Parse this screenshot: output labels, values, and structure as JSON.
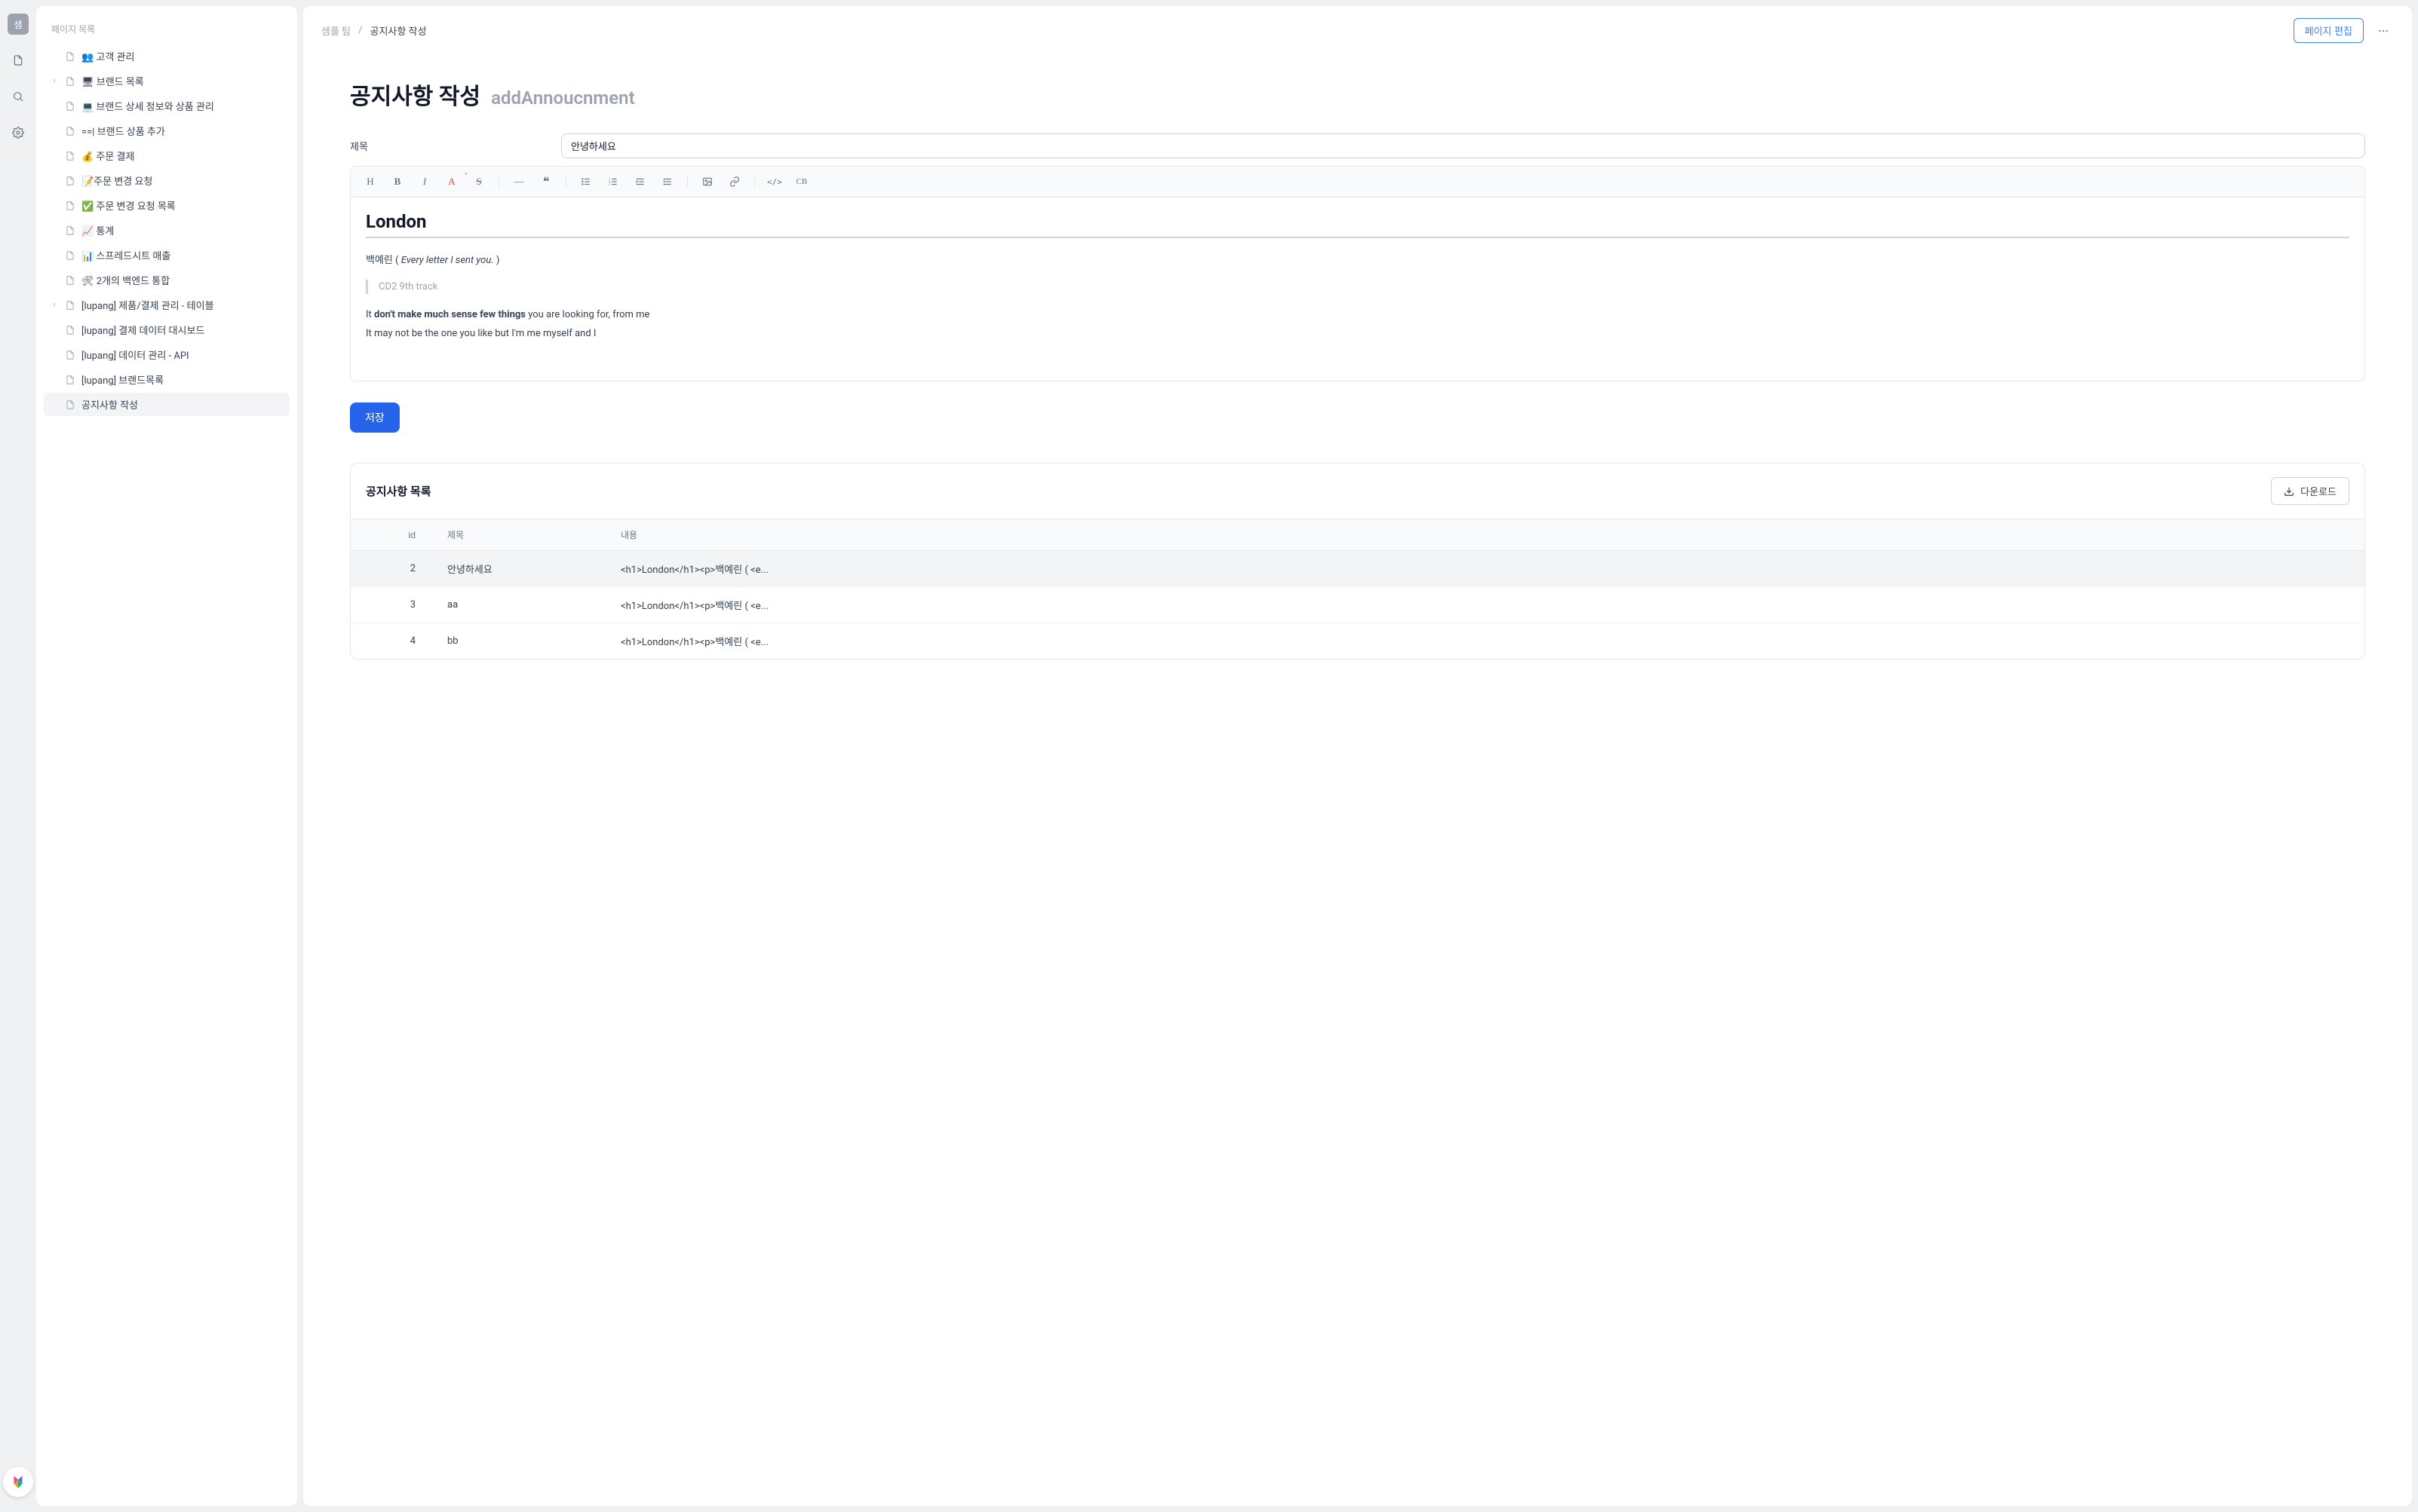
{
  "rail": {
    "avatar_initial": "샘"
  },
  "sidebar": {
    "title": "페이지 목록",
    "items": [
      {
        "label": "👥 고객 관리",
        "expandable": false
      },
      {
        "label": "🖥 브랜드 목록",
        "expandable": true
      },
      {
        "label": "💻 브랜드 상세 정보와 상품 관리",
        "expandable": false
      },
      {
        "label": "==| 브랜드 상품 추가",
        "expandable": false
      },
      {
        "label": "💰 주문 결제",
        "expandable": false
      },
      {
        "label": "📝주문 변경 요청",
        "expandable": false
      },
      {
        "label": "✅ 주문 변경 요청 목록",
        "expandable": false
      },
      {
        "label": "📈 통계",
        "expandable": false
      },
      {
        "label": "📊 스프레드시트 매출",
        "expandable": false
      },
      {
        "label": "🛠 2개의 백엔드 통합",
        "expandable": false
      },
      {
        "label": "[lupang] 제품/결제 관리 - 테이블",
        "expandable": true
      },
      {
        "label": "[lupang] 결제 데이터 대시보드",
        "expandable": false
      },
      {
        "label": "[lupang] 데이터 관리 - API",
        "expandable": false
      },
      {
        "label": "[lupang] 브랜드목록",
        "expandable": false
      },
      {
        "label": "공지사항 작성",
        "expandable": false,
        "active": true
      }
    ]
  },
  "breadcrumb": {
    "team": "샘플 팀",
    "page": "공지사항 작성"
  },
  "topbar": {
    "edit_button": "페이지 편집"
  },
  "page": {
    "title": "공지사항 작성",
    "subtitle": "addAnnoucnment"
  },
  "form": {
    "title_label": "제목",
    "title_value": "안녕하세요"
  },
  "toolbar": {
    "heading": "H",
    "bold": "B",
    "italic": "I",
    "color": "A",
    "strike": "S",
    "hr": "—",
    "quote": "❝",
    "ul": "ul",
    "ol": "ol",
    "indent_dec": "⇤",
    "indent_inc": "⇥",
    "image": "img",
    "link": "link",
    "code": "</>",
    "codeblock": "CB"
  },
  "editor": {
    "h1": "London",
    "line1_prefix": "백예린 ( ",
    "line1_italic": "Every letter I sent you.",
    "line1_suffix": " )",
    "blockquote": "CD2 9th track",
    "line2_prefix": "It ",
    "line2_bold": "don't make much sense few things",
    "line2_suffix": " you are looking for, from me",
    "line3": "It may not be the one you like but I'm me myself and I"
  },
  "actions": {
    "save": "저장"
  },
  "table_panel": {
    "title": "공지사항 목록",
    "download": "다운로드",
    "columns": {
      "id": "id",
      "title": "제목",
      "content": "내용"
    },
    "rows": [
      {
        "id": "2",
        "title": "안녕하세요",
        "content": "<h1>London</h1><p>백예린 ( <e...",
        "selected": true
      },
      {
        "id": "3",
        "title": "aa",
        "content": "<h1>London</h1><p>백예린 ( <e..."
      },
      {
        "id": "4",
        "title": "bb",
        "content": "<h1>London</h1><p>백예린 ( <e..."
      }
    ]
  }
}
